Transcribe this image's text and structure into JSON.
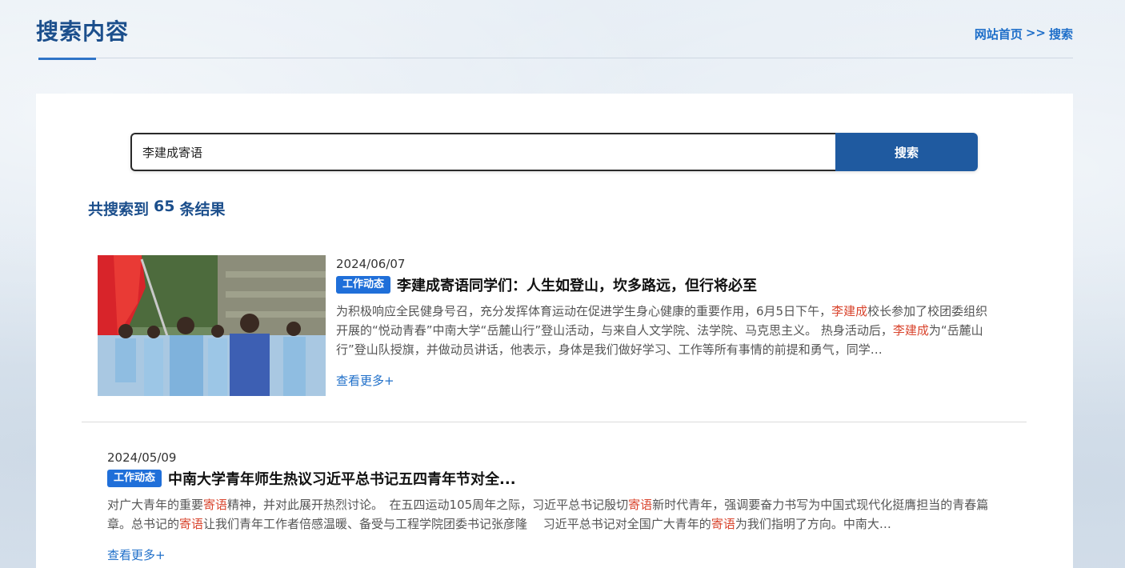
{
  "header": {
    "title": "搜索内容",
    "breadcrumb": {
      "home": "网站首页",
      "sep": ">>",
      "current": "搜索"
    }
  },
  "search": {
    "value": "李建成寄语",
    "button": "搜索"
  },
  "results_summary": {
    "prefix": "共搜索到",
    "count": "65",
    "suffix": "条结果"
  },
  "results": [
    {
      "date": "2024/06/07",
      "tag": "工作动态",
      "title": "李建成寄语同学们：人生如登山，坎多路远，但行将必至",
      "summary": [
        {
          "t": "为积极响应全民健身号召，充分发挥体育运动在促进学生身心健康的重要作用，6月5日下午，",
          "h": false
        },
        {
          "t": "李建成",
          "h": true
        },
        {
          "t": "校长参加了校团委组织开展的“悦动青春”中南大学“岳麓山行”登山活动，与来自人文学院、法学院、马克思主义。 热身活动后，",
          "h": false
        },
        {
          "t": "李建成",
          "h": true
        },
        {
          "t": "为“岳麓山行”登山队授旗，并做动员讲话，他表示，身体是我们做好学习、工作等所有事情的前提和勇气，同学…",
          "h": false
        }
      ],
      "more": "查看更多+"
    },
    {
      "date": "2024/05/09",
      "tag": "工作动态",
      "title": "中南大学青年师生热议习近平总书记五四青年节对全...",
      "summary": [
        {
          "t": "对广大青年的重要",
          "h": false
        },
        {
          "t": "寄语",
          "h": true
        },
        {
          "t": "精神，并对此展开热烈讨论。　在五四运动105周年之际，习近平总书记殷切",
          "h": false
        },
        {
          "t": "寄语",
          "h": true
        },
        {
          "t": "新时代青年，强调要奋力书写为中国式现代化挺膺担当的青春篇章。总书记的",
          "h": false
        },
        {
          "t": "寄语",
          "h": true
        },
        {
          "t": "让我们青年工作者倍感温暖、备受与工程学院团委书记张彦隆　 习近平总书记对全国广大青年的",
          "h": false
        },
        {
          "t": "寄语",
          "h": true
        },
        {
          "t": "为我们指明了方向。中南大…",
          "h": false
        }
      ],
      "more": "查看更多+"
    }
  ],
  "colors": {
    "brand": "#1c4f8c",
    "link": "#1f6fc9",
    "button": "#1f5aa0",
    "tag": "#1f6fd9",
    "highlight": "#d9452e"
  }
}
